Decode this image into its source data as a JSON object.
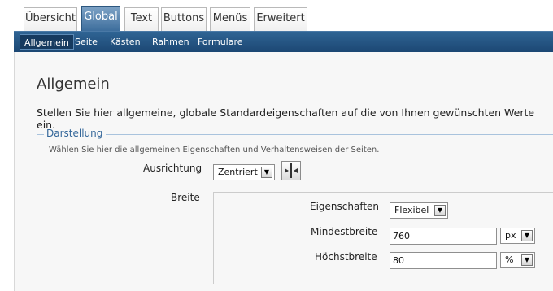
{
  "tabs": [
    {
      "label": "Übersicht",
      "active": false
    },
    {
      "label": "Global",
      "active": true
    },
    {
      "label": "Text",
      "active": false
    },
    {
      "label": "Buttons",
      "active": false
    },
    {
      "label": "Menüs",
      "active": false
    },
    {
      "label": "Erweitert",
      "active": false
    }
  ],
  "subnav": [
    {
      "label": "Allgemein",
      "active": true
    },
    {
      "label": "Seite",
      "active": false
    },
    {
      "label": "Kästen",
      "active": false
    },
    {
      "label": "Rahmen",
      "active": false
    },
    {
      "label": "Formulare",
      "active": false
    }
  ],
  "page": {
    "title": "Allgemein",
    "intro": "Stellen Sie hier allgemeine, globale Standardeigenschaften auf die von Ihnen gewünschten Werte ein."
  },
  "fieldset": {
    "legend": "Darstellung",
    "description": "Wählen Sie hier die allgemeinen Eigenschaften und Verhaltensweisen der Seiten."
  },
  "form": {
    "ausrichtung": {
      "label": "Ausrichtung",
      "value": "Zentriert"
    },
    "breite": {
      "label": "Breite"
    },
    "eigenschaften": {
      "label": "Eigenschaften",
      "value": "Flexibel"
    },
    "mindestbreite": {
      "label": "Mindestbreite",
      "value": "760",
      "unit": "px"
    },
    "hoechstbreite": {
      "label": "Höchstbreite",
      "value": "80",
      "unit": "%"
    }
  },
  "icons": {
    "dropdown": "chevron-down-icon",
    "align": "align-center-icon"
  },
  "colors": {
    "accent": "#1c4773",
    "tab_active": "#3b6c9b",
    "legend": "#336699"
  }
}
